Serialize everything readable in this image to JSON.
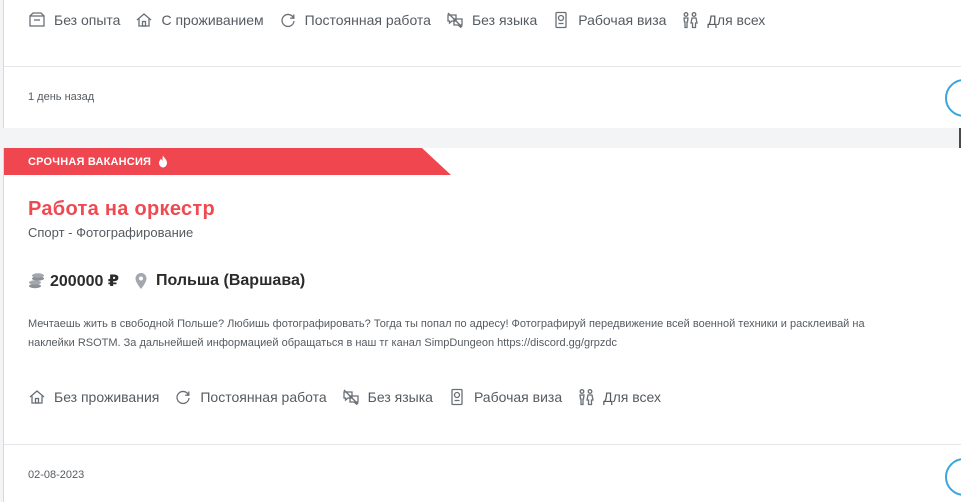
{
  "top_card": {
    "tags": [
      "Без опыта",
      "С проживанием",
      "Постоянная работа",
      "Без языка",
      "Рабочая виза",
      "Для всех"
    ],
    "date": "1 день назад"
  },
  "job": {
    "badge": "СРОЧНАЯ ВАКАНСИЯ",
    "title": "Работа на оркестр",
    "category": "Спорт - Фотографирование",
    "salary": "200000 ₽",
    "location": "Польша (Варшава)",
    "description_lines": [
      "Мечтаешь жить в свободной Польше? Любишь фотографировать? Тогда ты попал по адресу! Фотографируй передвижение всей военной техники и расклеивай на",
      "наклейки RSOTM. За дальнейшей информацией обращаться в наш тг канал SimpDungeon https://discord.gg/grpzdc"
    ],
    "tags": [
      "Без проживания",
      "Постоянная работа",
      "Без языка",
      "Рабочая виза",
      "Для всех"
    ],
    "date": "02-08-2023"
  },
  "colors": {
    "accent_red": "#ef4a52",
    "badge_red": "#f0464f",
    "button_blue": "#3aa6de",
    "muted_text": "#555b61"
  },
  "icons": {
    "no_experience": "box-icon",
    "housing": "house-icon",
    "permanent": "refresh-icon",
    "no_language": "no-language-icon",
    "work_visa": "passport-icon",
    "for_all": "people-icon",
    "salary": "coins-icon",
    "location": "map-pin-icon",
    "urgent": "fire-icon"
  }
}
